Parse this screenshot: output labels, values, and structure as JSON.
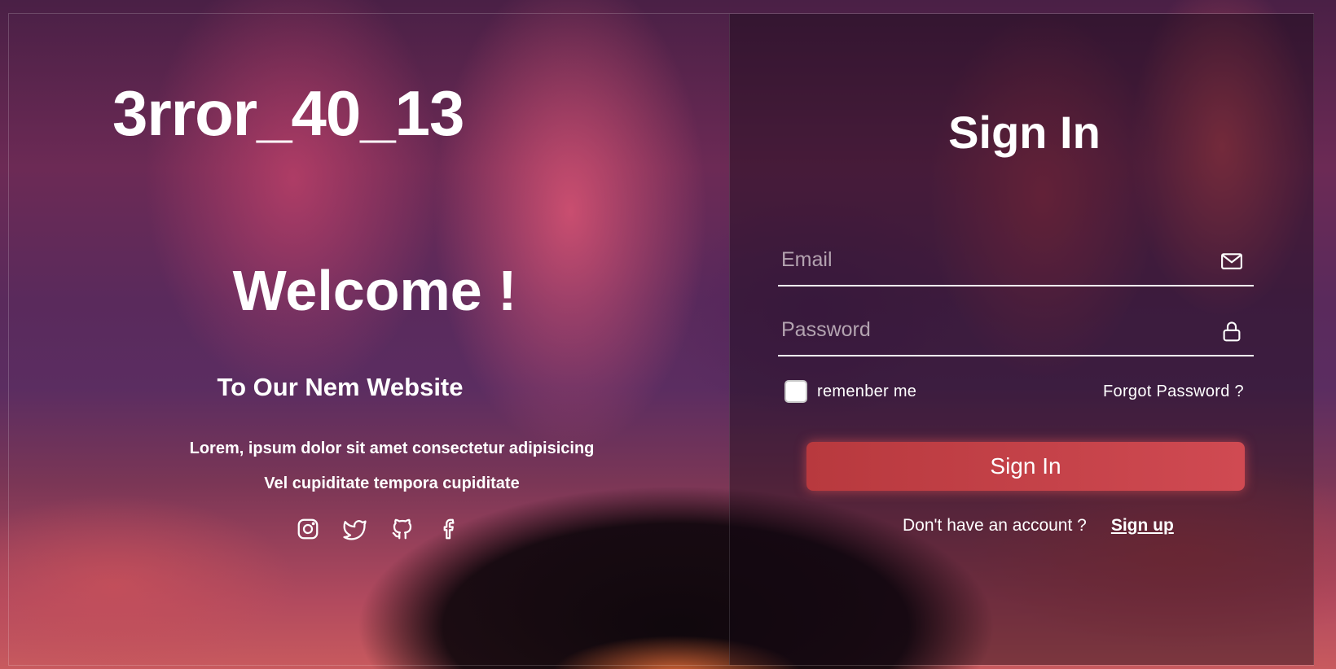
{
  "left": {
    "brand": "3rror_40_13",
    "welcome": "Welcome !",
    "subtitle": "To Our Nem Website",
    "description_line1": "Lorem, ipsum dolor sit amet consectetur adipisicing",
    "description_line2": "Vel cupiditate tempora cupiditate",
    "social_icons": [
      "instagram-icon",
      "twitter-icon",
      "github-icon",
      "facebook-icon"
    ]
  },
  "form": {
    "title": "Sign In",
    "email": {
      "placeholder": "Email",
      "value": "",
      "icon": "envelope-icon"
    },
    "password": {
      "placeholder": "Password",
      "value": "",
      "icon": "lock-icon"
    },
    "remember_label": "remenber me",
    "remember_checked": false,
    "forgot_label": "Forgot Password ?",
    "submit_label": "Sign In",
    "no_account_text": "Don't have an account ?",
    "signup_label": "Sign up"
  },
  "colors": {
    "accent": "#c6434a",
    "text": "#ffffff"
  }
}
